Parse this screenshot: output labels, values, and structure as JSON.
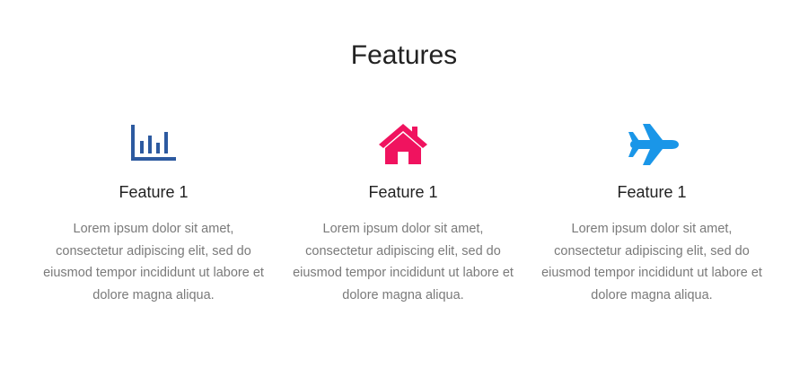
{
  "section": {
    "title": "Features"
  },
  "features": [
    {
      "icon": "bar-chart-icon",
      "color": "#2d5aa0",
      "title": "Feature 1",
      "text": "Lorem ipsum dolor sit amet, consectetur adipiscing elit, sed do eiusmod tempor incididunt ut labore et dolore magna aliqua."
    },
    {
      "icon": "home-icon",
      "color": "#f0135f",
      "title": "Feature 1",
      "text": "Lorem ipsum dolor sit amet, consectetur adipiscing elit, sed do eiusmod tempor incididunt ut labore et dolore magna aliqua."
    },
    {
      "icon": "airplane-icon",
      "color": "#1a96e8",
      "title": "Feature 1",
      "text": "Lorem ipsum dolor sit amet, consectetur adipiscing elit, sed do eiusmod tempor incididunt ut labore et dolore magna aliqua."
    }
  ]
}
